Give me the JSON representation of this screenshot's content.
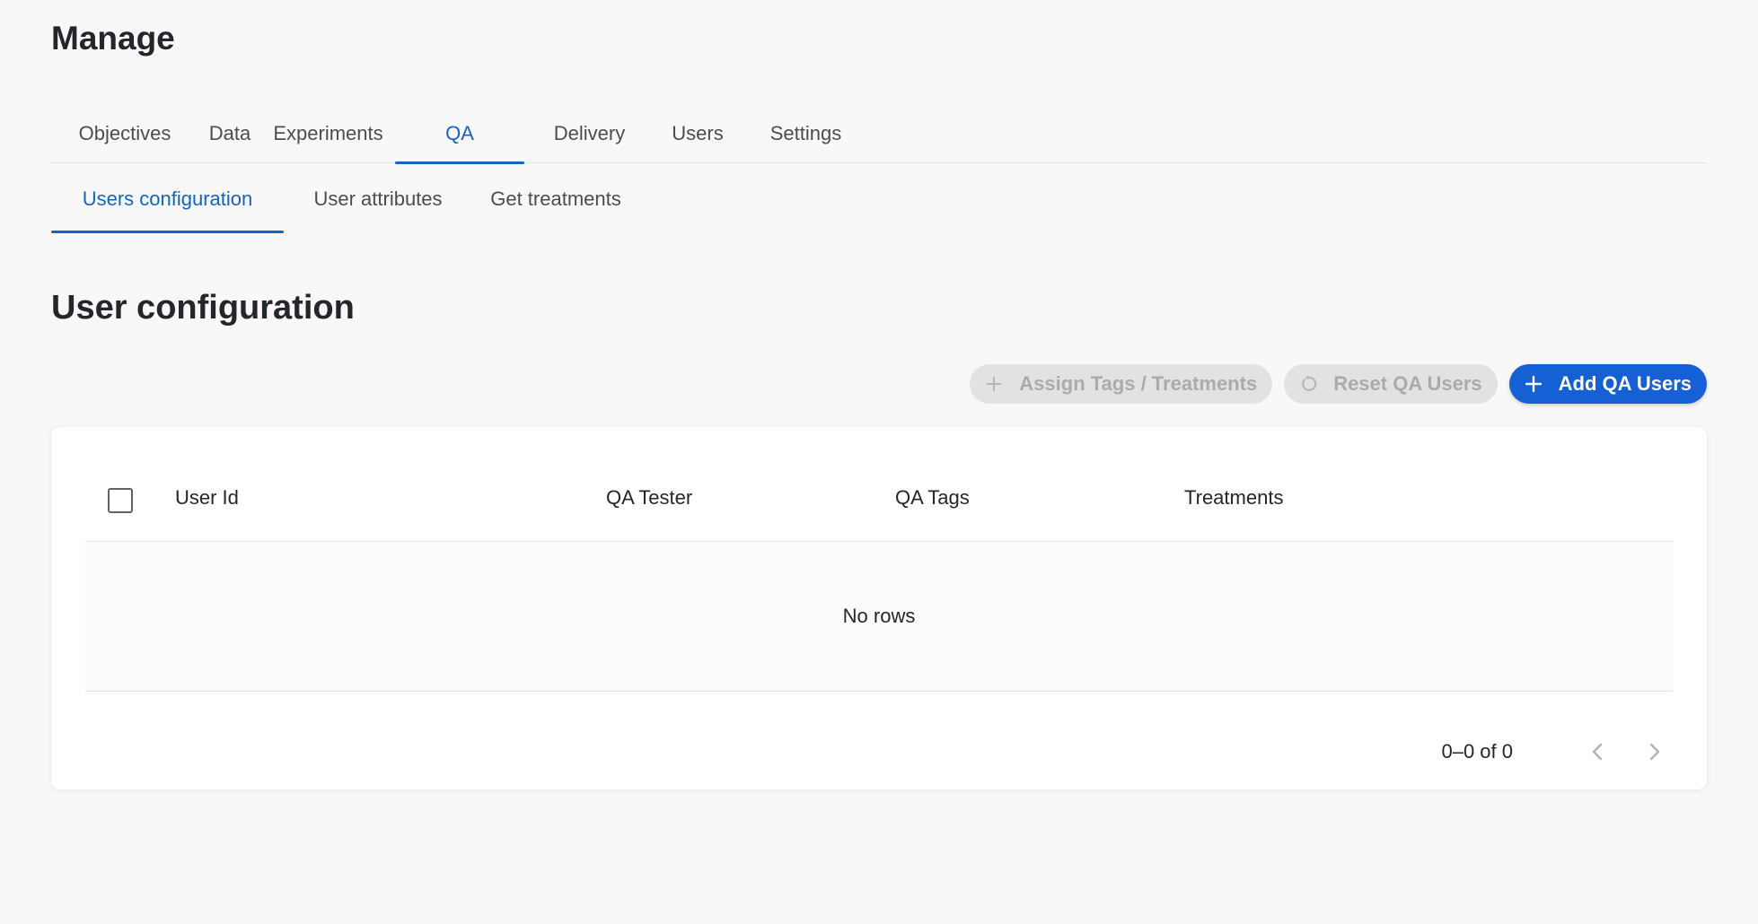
{
  "page": {
    "title": "Manage"
  },
  "main_tabs": [
    {
      "label": "Objectives",
      "active": false
    },
    {
      "label": "Data",
      "active": false
    },
    {
      "label": "Experiments",
      "active": false
    },
    {
      "label": "QA",
      "active": true
    },
    {
      "label": "Delivery",
      "active": false
    },
    {
      "label": "Users",
      "active": false
    },
    {
      "label": "Settings",
      "active": false
    }
  ],
  "sub_tabs": [
    {
      "label": "Users configuration",
      "active": true
    },
    {
      "label": "User attributes",
      "active": false
    },
    {
      "label": "Get treatments",
      "active": false
    }
  ],
  "section": {
    "title": "User configuration"
  },
  "toolbar": {
    "assign_label": "Assign Tags / Treatments",
    "assign_icon": "plus-icon",
    "reset_label": "Reset QA Users",
    "reset_icon": "refresh-icon",
    "add_label": "Add QA Users",
    "add_icon": "plus-icon"
  },
  "table": {
    "columns": [
      "User Id",
      "QA Tester",
      "QA Tags",
      "Treatments"
    ],
    "empty_text": "No rows",
    "pagination": "0–0 of 0"
  },
  "colors": {
    "accent": "#1565c0",
    "primary_button": "#1660d6",
    "disabled_button": "#e2e2e2"
  }
}
